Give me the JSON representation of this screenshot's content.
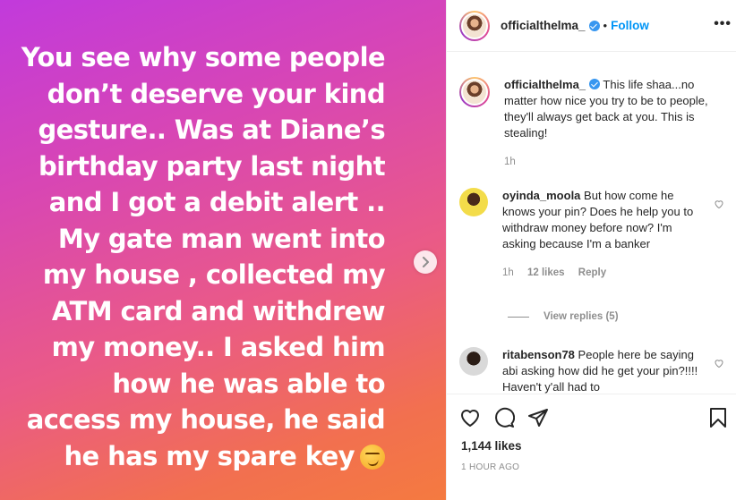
{
  "post": {
    "image_text": "You see why some people\ndon’t deserve your  kind\ngesture.. Was  at Diane’s\nbirthday party last night\nand I got a debit alert ..\nMy gate man went into\nmy house , collected my\nATM card and withdrew\nmy money.. I asked him\nhow he was able to\naccess my house, he said\nhe has my  spare key",
    "emoji": "smirking-face",
    "gradient_colors": [
      "#c13adc",
      "#d846b4",
      "#ea5a87",
      "#f2704f",
      "#f47a40"
    ]
  },
  "header": {
    "username": "officialthelma_",
    "separator": "•",
    "follow_label": "Follow",
    "more_label": "•••"
  },
  "caption": {
    "username": "officialthelma_",
    "text": "This life shaa...no matter how nice you try to be to people, they'll always get back at you. This is stealing!",
    "time": "1h"
  },
  "comments": [
    {
      "username": "oyinda_moola",
      "text": "But how come he knows your pin? Does he help you to withdraw money before now? I'm asking because I'm a banker",
      "time": "1h",
      "likes": "12 likes",
      "reply_label": "Reply",
      "view_replies": "View replies (5)"
    },
    {
      "username": "ritabenson78",
      "text": "People here be saying abi asking how did he get your pin?!!!! Haven't y'all had to"
    }
  ],
  "actions": {
    "likes": "1,144 likes",
    "time_ago": "1 HOUR AGO"
  },
  "colors": {
    "accent": "#0095f6",
    "verified": "#3897f0",
    "muted": "#8e8e8e",
    "text": "#262626"
  }
}
